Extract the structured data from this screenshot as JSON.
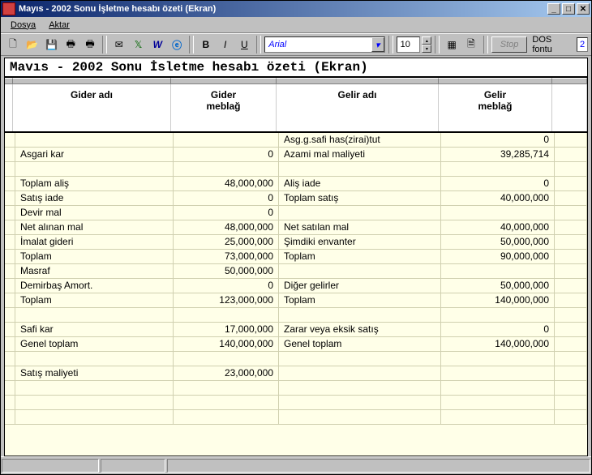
{
  "window": {
    "title": "Mayıs   - 2002 Sonu İşletme hesabı özeti (Ekran)"
  },
  "menu": {
    "dosya": "Dosya",
    "aktar": "Aktar"
  },
  "toolbar": {
    "font_name": "Arial",
    "font_size": "10",
    "stop": "Stop",
    "dos_label": "DOS fontu",
    "dos_val": "2"
  },
  "doc_title": "Mavıs   - 2002 Sonu İsletme hesabı özeti (Ekran)",
  "columns": {
    "gider_adi": "Gider adı",
    "gider_meblag": "Gider\nmeblağ",
    "gelir_adi": "Gelir adı",
    "gelir_meblag": "Gelir\nmeblağ"
  },
  "rows": [
    {
      "c1": "",
      "c2": "",
      "c3": "Asg.g.safi has(zirai)tut",
      "c4": "0"
    },
    {
      "c1": "Asgari kar",
      "c2": "0",
      "c3": "Azami mal maliyeti",
      "c4": "39,285,714"
    },
    {
      "c1": "",
      "c2": "",
      "c3": "",
      "c4": ""
    },
    {
      "c1": "Toplam aliş",
      "c2": "48,000,000",
      "c3": "Aliş iade",
      "c4": "0"
    },
    {
      "c1": "Satış iade",
      "c2": "0",
      "c3": "Toplam satış",
      "c4": "40,000,000"
    },
    {
      "c1": "Devir mal",
      "c2": "0",
      "c3": "",
      "c4": ""
    },
    {
      "c1": "Net alınan mal",
      "c2": "48,000,000",
      "c3": "Net satılan mal",
      "c4": "40,000,000"
    },
    {
      "c1": "İmalat gideri",
      "c2": "25,000,000",
      "c3": "Şimdiki envanter",
      "c4": "50,000,000"
    },
    {
      "c1": "Toplam",
      "c2": "73,000,000",
      "c3": "Toplam",
      "c4": "90,000,000"
    },
    {
      "c1": "Masraf",
      "c2": "50,000,000",
      "c3": "",
      "c4": ""
    },
    {
      "c1": "Demirbaş Amort.",
      "c2": "0",
      "c3": "Diğer gelirler",
      "c4": "50,000,000"
    },
    {
      "c1": "Toplam",
      "c2": "123,000,000",
      "c3": "Toplam",
      "c4": "140,000,000"
    },
    {
      "c1": "",
      "c2": "",
      "c3": "",
      "c4": ""
    },
    {
      "c1": "Safi kar",
      "c2": "17,000,000",
      "c3": "Zarar veya eksik satış",
      "c4": "0"
    },
    {
      "c1": "Genel toplam",
      "c2": "140,000,000",
      "c3": "Genel toplam",
      "c4": "140,000,000"
    },
    {
      "c1": "",
      "c2": "",
      "c3": "",
      "c4": ""
    },
    {
      "c1": "Satış maliyeti",
      "c2": "23,000,000",
      "c3": "",
      "c4": ""
    },
    {
      "c1": "",
      "c2": "",
      "c3": "",
      "c4": ""
    },
    {
      "c1": "",
      "c2": "",
      "c3": "",
      "c4": ""
    },
    {
      "c1": "",
      "c2": "",
      "c3": "",
      "c4": ""
    }
  ]
}
